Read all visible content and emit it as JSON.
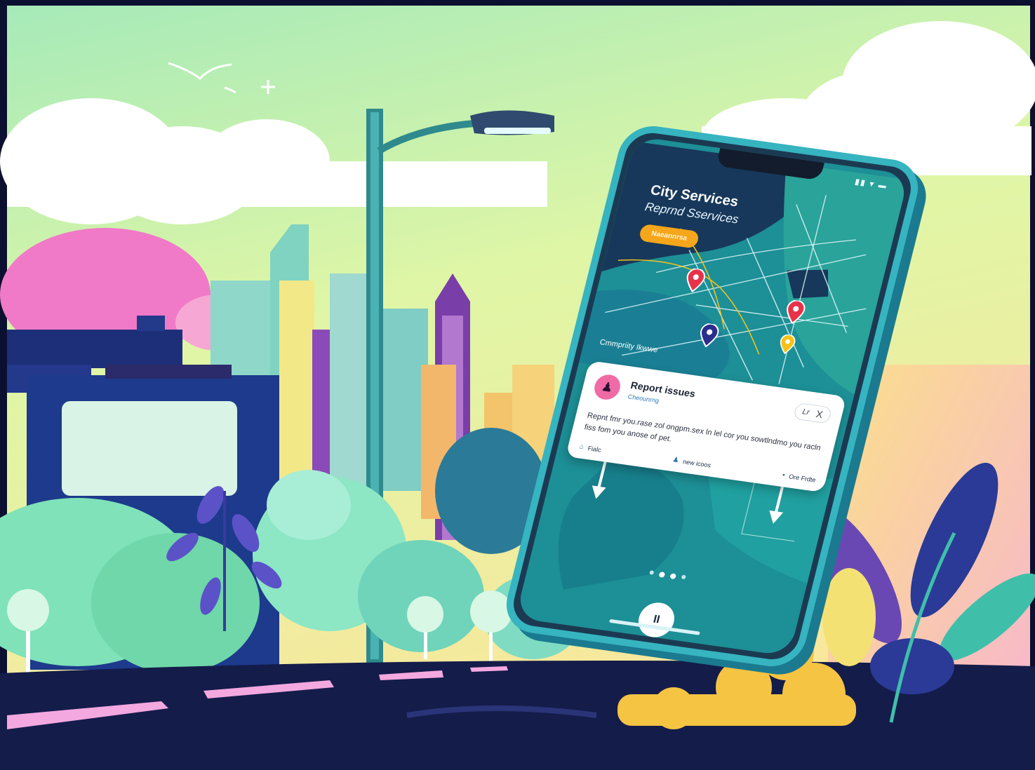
{
  "app": {
    "title": "City Services",
    "subtitle": "Reprnd Sservices",
    "pill_label": "Naeannrsa",
    "map_label": "Cmmpriity Ikwwe",
    "status_icons": "▮▮ ▾ ▬"
  },
  "card": {
    "avatar_icon": "person-icon",
    "title": "Report issues",
    "meta": "Cheounrng",
    "edit_label": "Lr",
    "close_label": "X",
    "body": "Repnt fmr you.rase zol ongpm.sex ln lel cor you sowtlndmo you racln fiss fom you anose of pet.",
    "actions": [
      {
        "icon": "⌂",
        "label": "Fialc"
      },
      {
        "icon": "♟",
        "label": "new icoos"
      },
      {
        "icon": "▪",
        "label": "Ore Frdte"
      }
    ]
  },
  "controls": {
    "play_label": "II"
  },
  "colors": {
    "sky_top": "#a8ecc0",
    "sky_bottom": "#f6f4a8",
    "phone_frame": "#36b4c0",
    "map_water": "#1d8f96",
    "pill": "#f5a61a",
    "pin_red": "#e8324a",
    "pin_blue": "#2a2e8c",
    "pin_yellow": "#f5c21a",
    "road": "#141c4a"
  }
}
